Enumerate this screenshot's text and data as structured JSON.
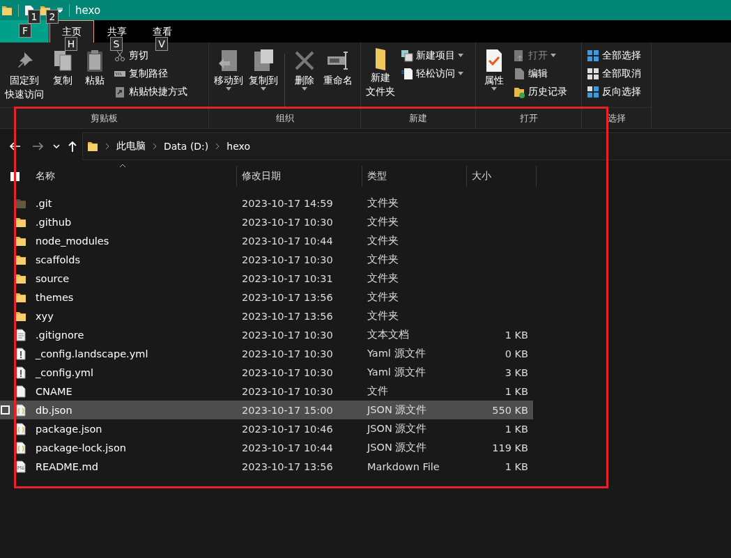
{
  "title_bar": {
    "title": "hexo"
  },
  "keytips": [
    {
      "key": "1",
      "kind": "qa1"
    },
    {
      "key": "2",
      "kind": "qa2"
    },
    {
      "key": "F",
      "kind": "file"
    },
    {
      "key": "H",
      "kind": "home"
    },
    {
      "key": "S",
      "kind": "share"
    },
    {
      "key": "V",
      "kind": "view"
    }
  ],
  "tabs": [
    {
      "kind": "file",
      "selected": false
    },
    {
      "label": "主页",
      "kind": "tab",
      "selected": true
    },
    {
      "label": "共享",
      "kind": "tab",
      "selected": false
    },
    {
      "label": "查看",
      "kind": "tab",
      "selected": false
    }
  ],
  "ribbon": [
    {
      "label": "剪贴板",
      "items": [
        {
          "kind": "large",
          "lines": [
            "固定到",
            "快速访问"
          ],
          "dropdown": false,
          "disabled": false
        },
        {
          "kind": "large",
          "lines": [
            "复制"
          ],
          "dropdown": false,
          "disabled": false
        },
        {
          "kind": "large",
          "lines": [
            "粘贴"
          ],
          "dropdown": false,
          "disabled": false
        },
        {
          "kind": "small",
          "label": "剪切",
          "dropdown": false,
          "disabled": false
        },
        {
          "kind": "small",
          "label": "复制路径",
          "dropdown": false,
          "disabled": false
        },
        {
          "kind": "small",
          "label": "粘贴快捷方式",
          "dropdown": false,
          "disabled": false
        }
      ]
    },
    {
      "label": "组织",
      "items": [
        {
          "kind": "large",
          "lines": [
            "移动到"
          ],
          "dropdown": true,
          "disabled": false
        },
        {
          "kind": "large",
          "lines": [
            "复制到"
          ],
          "dropdown": true,
          "disabled": false
        },
        {
          "kind": "separator"
        },
        {
          "kind": "large",
          "lines": [
            "删除"
          ],
          "dropdown": true,
          "disabled": false
        },
        {
          "kind": "large",
          "lines": [
            "重命名"
          ],
          "dropdown": false,
          "disabled": false
        }
      ]
    },
    {
      "label": "新建",
      "items": [
        {
          "kind": "large",
          "lines": [
            "新建",
            "文件夹"
          ],
          "dropdown": false,
          "disabled": false
        },
        {
          "kind": "small",
          "label": "新建项目",
          "dropdown": true,
          "disabled": false
        },
        {
          "kind": "small",
          "label": "轻松访问",
          "dropdown": true,
          "disabled": false
        }
      ]
    },
    {
      "label": "打开",
      "items": [
        {
          "kind": "large",
          "lines": [
            "属性"
          ],
          "dropdown": true,
          "disabled": false
        },
        {
          "kind": "small",
          "label": "打开",
          "dropdown": true,
          "disabled": true
        },
        {
          "kind": "small",
          "label": "编辑",
          "dropdown": false,
          "disabled": false
        },
        {
          "kind": "small",
          "label": "历史记录",
          "dropdown": false,
          "disabled": false
        }
      ]
    },
    {
      "label": "选择",
      "items": [
        {
          "kind": "small",
          "label": "全部选择",
          "dropdown": false,
          "disabled": false
        },
        {
          "kind": "small",
          "label": "全部取消",
          "dropdown": false,
          "disabled": false
        },
        {
          "kind": "small",
          "label": "反向选择",
          "dropdown": false,
          "disabled": false
        }
      ]
    }
  ],
  "navigation": {
    "back_disabled": false,
    "forward_disabled": true,
    "breadcrumb": [
      "此电脑",
      "Data (D:)",
      "hexo"
    ]
  },
  "columns": [
    "名称",
    "修改日期",
    "类型",
    "大小"
  ],
  "select_all": {
    "checked": true
  },
  "files": [
    {
      "name": ".git",
      "modified": "2023-10-17 14:59",
      "type": "文件夹",
      "kind": "folder",
      "hidden": true,
      "selected": false
    },
    {
      "name": ".github",
      "modified": "2023-10-17 10:30",
      "type": "文件夹",
      "kind": "folder",
      "hidden": false,
      "selected": false
    },
    {
      "name": "node_modules",
      "modified": "2023-10-17 10:44",
      "type": "文件夹",
      "kind": "folder",
      "hidden": false,
      "selected": false
    },
    {
      "name": "scaffolds",
      "modified": "2023-10-17 10:30",
      "type": "文件夹",
      "kind": "folder",
      "hidden": false,
      "selected": false
    },
    {
      "name": "source",
      "modified": "2023-10-17 10:31",
      "type": "文件夹",
      "kind": "folder",
      "hidden": false,
      "selected": false
    },
    {
      "name": "themes",
      "modified": "2023-10-17 13:56",
      "type": "文件夹",
      "kind": "folder",
      "hidden": false,
      "selected": false
    },
    {
      "name": "xyy",
      "modified": "2023-10-17 13:56",
      "type": "文件夹",
      "kind": "folder",
      "hidden": false,
      "selected": false
    },
    {
      "name": ".gitignore",
      "modified": "2023-10-17 10:30",
      "type": "文本文档",
      "size": "1 KB",
      "kind": "text",
      "hidden": false,
      "selected": false
    },
    {
      "name": "_config.landscape.yml",
      "modified": "2023-10-17 10:30",
      "type": "Yaml 源文件",
      "size": "0 KB",
      "kind": "yaml",
      "hidden": false,
      "selected": false
    },
    {
      "name": "_config.yml",
      "modified": "2023-10-17 10:30",
      "type": "Yaml 源文件",
      "size": "3 KB",
      "kind": "yaml",
      "hidden": false,
      "selected": false
    },
    {
      "name": "CNAME",
      "modified": "2023-10-17 10:30",
      "type": "文件",
      "size": "1 KB",
      "kind": "file",
      "hidden": false,
      "selected": false
    },
    {
      "name": "db.json",
      "modified": "2023-10-17 15:00",
      "type": "JSON 源文件",
      "size": "550 KB",
      "kind": "json",
      "hidden": false,
      "selected": true
    },
    {
      "name": "package.json",
      "modified": "2023-10-17 10:46",
      "type": "JSON 源文件",
      "size": "1 KB",
      "kind": "json",
      "hidden": false,
      "selected": false
    },
    {
      "name": "package-lock.json",
      "modified": "2023-10-17 10:44",
      "type": "JSON 源文件",
      "size": "119 KB",
      "kind": "json",
      "hidden": false,
      "selected": false
    },
    {
      "name": "README.md",
      "modified": "2023-10-17 13:56",
      "type": "Markdown File",
      "size": "1 KB",
      "kind": "md",
      "hidden": false,
      "selected": false
    }
  ]
}
